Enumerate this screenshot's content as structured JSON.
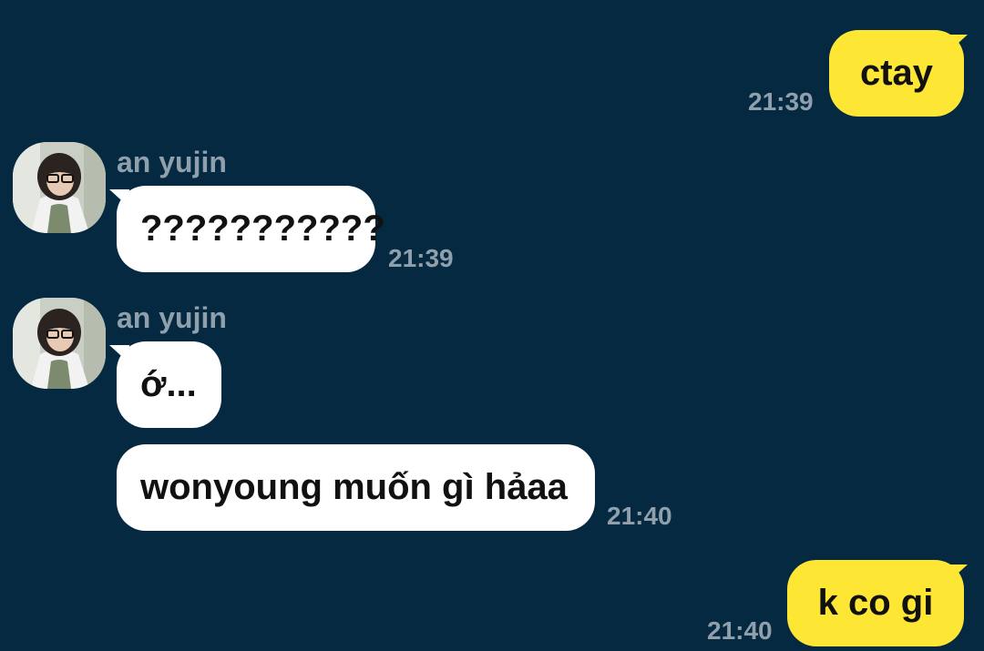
{
  "theme": {
    "background": "#042941",
    "outgoing_bubble": "#FEE634",
    "incoming_bubble": "#FFFFFF",
    "meta_text": "#8FA0AC"
  },
  "messages": [
    {
      "direction": "outgoing",
      "text": "ctay",
      "time": "21:39"
    },
    {
      "direction": "incoming",
      "sender": "an yujin",
      "text": "???????????",
      "time": "21:39"
    },
    {
      "direction": "incoming",
      "sender": "an yujin",
      "text": "ớ...",
      "time": ""
    },
    {
      "direction": "incoming",
      "sender": "",
      "text": "wonyoung muốn gì hảaa",
      "time": "21:40"
    },
    {
      "direction": "outgoing",
      "text": "k co gi",
      "time": "21:40"
    }
  ],
  "avatar_icon": "user-photo"
}
